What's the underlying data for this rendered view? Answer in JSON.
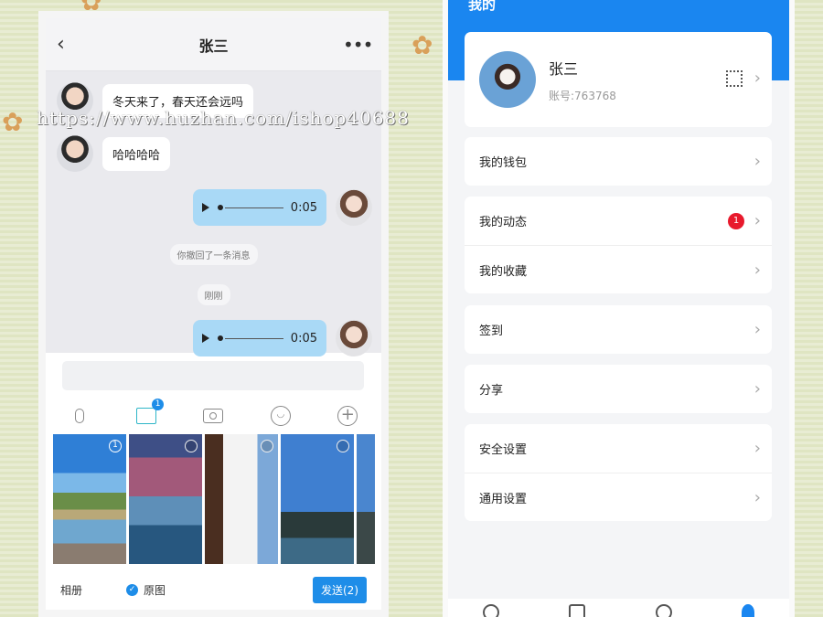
{
  "chat": {
    "title": "张三",
    "back_icon": "chevron-left-icon",
    "more_icon": "more-dots-icon",
    "messages": [
      {
        "type": "text",
        "side": "left",
        "text": "冬天来了，春天还会远吗"
      },
      {
        "type": "text",
        "side": "left",
        "text": "哈哈哈哈"
      },
      {
        "type": "voice",
        "side": "right",
        "duration": "0:05"
      },
      {
        "type": "system",
        "text": "你撤回了一条消息"
      },
      {
        "type": "system",
        "text": "刚刚"
      },
      {
        "type": "voice",
        "side": "right",
        "duration": "0:05"
      }
    ],
    "toolbar": {
      "icons": [
        "microphone-icon",
        "image-icon",
        "camera-icon",
        "emoji-icon",
        "plus-icon"
      ],
      "image_badge": "1"
    },
    "photos": {
      "selected_index_label": "1"
    },
    "bottom": {
      "album_label": "相册",
      "original_label": "原图",
      "send_label": "发送(2)"
    }
  },
  "watermark": "https://www.huzhan.com/ishop40688",
  "profile": {
    "header_title": "我的",
    "name": "张三",
    "account": "账号:763768",
    "qr_icon": "qr-code-icon"
  },
  "menu": {
    "wallet": "我的钱包",
    "moments": "我的动态",
    "moments_badge": "1",
    "favorites": "我的收藏",
    "checkin": "签到",
    "share": "分享",
    "security": "安全设置",
    "general": "通用设置"
  },
  "tabbar": {
    "icons": [
      "chat-icon",
      "contacts-icon",
      "discover-icon",
      "me-icon"
    ]
  },
  "colors": {
    "accent_blue": "#1a86f0",
    "voice_bubble": "#a9d9f6",
    "badge_red": "#e8192c"
  }
}
